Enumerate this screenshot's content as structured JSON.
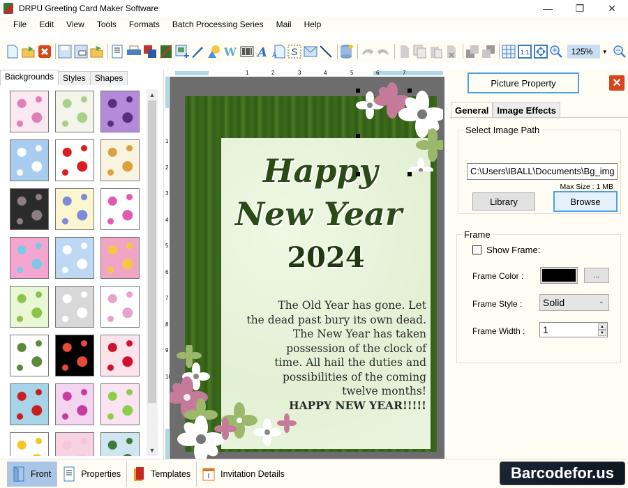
{
  "window": {
    "title": "DRPU Greeting Card Maker Software",
    "controls": {
      "minimize": "—",
      "restore": "❐",
      "close": "✕"
    }
  },
  "menubar": {
    "items": [
      "File",
      "Edit",
      "View",
      "Tools",
      "Formats",
      "Batch Processing Series",
      "Mail",
      "Help"
    ]
  },
  "toolbar": {
    "icons": [
      "new-icon",
      "open-icon",
      "close-icon",
      "save-icon",
      "save-as-icon",
      "open-folder-icon",
      "properties-icon",
      "print-icon",
      "layers-icon",
      "image-crop-icon",
      "add-image-icon",
      "pen-icon",
      "shapes-icon",
      "wordart-icon",
      "barcode-icon",
      "text-icon",
      "document-text-icon",
      "signature-icon",
      "mail-icon",
      "line-icon",
      "database-icon",
      "undo-icon",
      "redo-icon",
      "cut-icon",
      "copy-icon",
      "paste-icon",
      "delete-icon",
      "bring-front-icon",
      "send-back-icon",
      "grid-icon",
      "actual-size-icon",
      "fit-window-icon",
      "zoom-in-icon",
      "zoom-out-icon"
    ],
    "zoom_value": "125%"
  },
  "left_panel": {
    "tabs": [
      "Backgrounds",
      "Styles",
      "Shapes"
    ],
    "active_tab": "Backgrounds",
    "thumbnails": [
      {
        "name": "baby-pink-pattern",
        "colors": [
          "#fbe9f2",
          "#e17dbb"
        ]
      },
      {
        "name": "baby-pastel-pattern",
        "colors": [
          "#f5f4ea",
          "#a8d08d"
        ]
      },
      {
        "name": "purple-floral",
        "colors": [
          "#b48ad9",
          "#5b2d7c"
        ]
      },
      {
        "name": "clouds-sky",
        "colors": [
          "#a8ccf0",
          "#ffffff"
        ]
      },
      {
        "name": "strawberries",
        "colors": [
          "#ffffff",
          "#d81e1e"
        ]
      },
      {
        "name": "autumn-leaves",
        "colors": [
          "#f9f3e1",
          "#d9a23a"
        ]
      },
      {
        "name": "dark-roses",
        "colors": [
          "#2b2b2b",
          "#8d7e85"
        ]
      },
      {
        "name": "flower-rows",
        "colors": [
          "#fbf6cf",
          "#7b8ad9"
        ]
      },
      {
        "name": "gift-boxes",
        "colors": [
          "#ffffff",
          "#e05ab0"
        ]
      },
      {
        "name": "pastel-blossoms",
        "colors": [
          "#f4a6d0",
          "#7ec8e3"
        ]
      },
      {
        "name": "blue-snowflakes",
        "colors": [
          "#bcd8f2",
          "#ffffff"
        ]
      },
      {
        "name": "colorful-circles",
        "colors": [
          "#f1a5c4",
          "#f5c842"
        ]
      },
      {
        "name": "christmas-trees",
        "colors": [
          "#eaf7d5",
          "#8bc34a"
        ]
      },
      {
        "name": "white-heart",
        "colors": [
          "#d8d8d8",
          "#ffffff"
        ]
      },
      {
        "name": "kids-party",
        "colors": [
          "#ffffff",
          "#e7a4c8"
        ]
      },
      {
        "name": "green-ornaments",
        "colors": [
          "#ffffff",
          "#5a8a3a"
        ]
      },
      {
        "name": "fireworks",
        "colors": [
          "#000000",
          "#e84a3a"
        ]
      },
      {
        "name": "red-hearts",
        "colors": [
          "#fde4ea",
          "#d0102c"
        ]
      },
      {
        "name": "santa-pattern",
        "colors": [
          "#a8d4ea",
          "#c81e1e"
        ]
      },
      {
        "name": "pink-dandelions",
        "colors": [
          "#f3d5ef",
          "#c73aa0"
        ]
      },
      {
        "name": "pink-lilies",
        "colors": [
          "#fbe4f1",
          "#8bcf49"
        ]
      },
      {
        "name": "stars",
        "colors": [
          "#ffffff",
          "#f5c623"
        ]
      },
      {
        "name": "pink-texture",
        "colors": [
          "#f7d2e0",
          "#f5c6d8"
        ]
      },
      {
        "name": "snowman-pattern",
        "colors": [
          "#cfe5ef",
          "#3d7a3a"
        ]
      }
    ]
  },
  "canvas": {
    "ruler_h": [
      "1",
      "2",
      "3",
      "4",
      "5",
      "6",
      "7"
    ],
    "ruler_v": [
      "1",
      "2",
      "3",
      "4",
      "5",
      "6",
      "7",
      "8",
      "9",
      "10"
    ],
    "card": {
      "title_line1": "Happy",
      "title_line2": "New Year",
      "year": "2024",
      "poem_lines": [
        "The Old Year has gone. Let",
        "the dead past bury its own dead.",
        "The New Year has taken",
        "possession of the clock of",
        "time. All hail the duties and",
        "possibilities of the coming",
        "twelve months!",
        "HAPPY NEW YEAR!!!!!"
      ],
      "colors": {
        "frame": "#3b6a1c",
        "inner": "#e8f4dc",
        "text": "#2a4a16"
      }
    }
  },
  "right_panel": {
    "header_button": "Picture Property",
    "tabs": [
      "General",
      "Image Effects"
    ],
    "active_tab": "General",
    "image_path": {
      "legend": "Select Image Path",
      "value": "C:\\Users\\IBALL\\Documents\\Bg_img",
      "max_size": "Max Size : 1 MB",
      "library_label": "Library",
      "browse_label": "Browse"
    },
    "frame": {
      "legend": "Frame",
      "show_frame_label": "Show Frame:",
      "show_frame_checked": false,
      "color_label": "Frame Color :",
      "color_value": "#000000",
      "color_picker_label": "...",
      "style_label": "Frame Style :",
      "style_value": "Solid",
      "width_label": "Frame Width :",
      "width_value": "1"
    }
  },
  "statusbar": {
    "items": [
      {
        "label": "Front",
        "icon": "front-page-icon",
        "active": true
      },
      {
        "label": "Properties",
        "icon": "properties-icon",
        "active": false
      },
      {
        "label": "Templates",
        "icon": "templates-icon",
        "active": false
      },
      {
        "label": "Invitation Details",
        "icon": "invitation-details-icon",
        "active": false
      }
    ],
    "brand": "Barcodefor.us"
  }
}
